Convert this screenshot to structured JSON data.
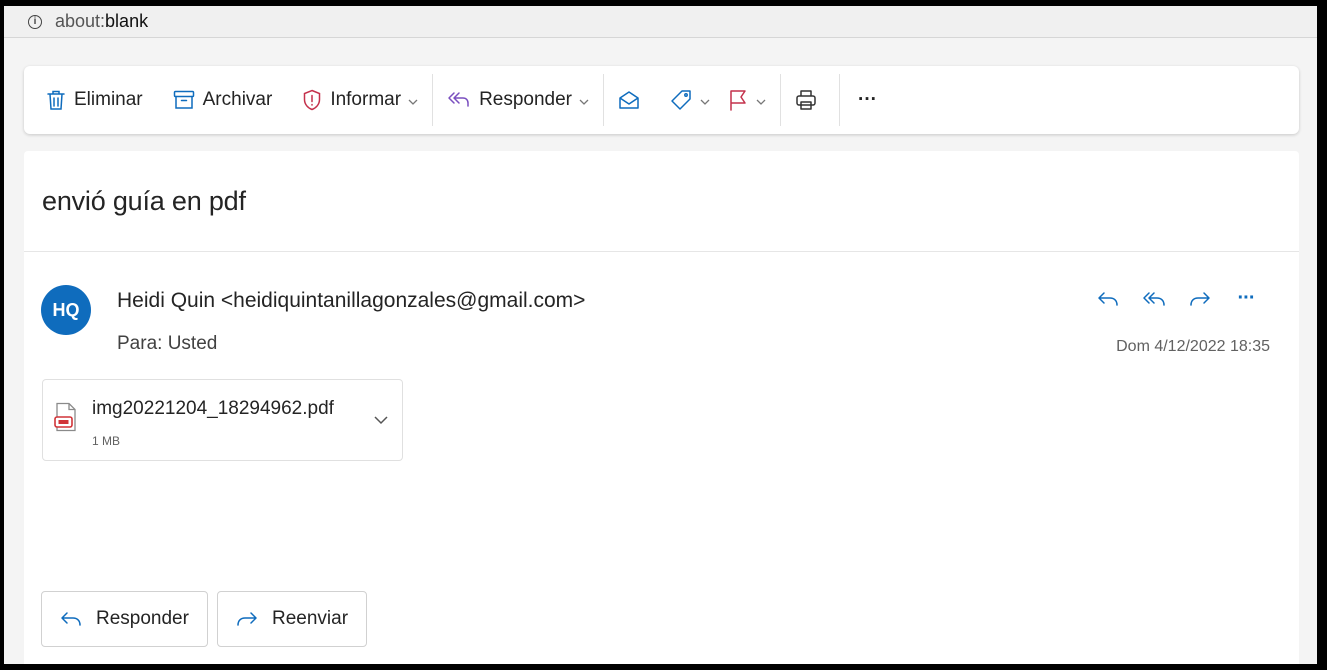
{
  "browser": {
    "info_glyph": "i",
    "url_scheme": "about:",
    "url_host": "blank"
  },
  "toolbar": {
    "delete_label": "Eliminar",
    "archive_label": "Archivar",
    "report_label": "Informar",
    "reply_label": "Responder",
    "more_label": "···"
  },
  "message": {
    "subject": "envió guía en pdf",
    "avatar_initials": "HQ",
    "avatar_color": "#0f6cbd",
    "sender": "Heidi Quin <heidiquintanillagonzales@gmail.com>",
    "to_line": "Para: Usted",
    "date": "Dom 4/12/2022 18:35",
    "more_label": "···"
  },
  "attachment": {
    "name": "img20221204_18294962.pdf",
    "size": "1 MB",
    "icon": "pdf-file-icon"
  },
  "footer": {
    "reply_label": "Responder",
    "forward_label": "Reenviar"
  },
  "colors": {
    "accent": "#0f6cbd",
    "report_red": "#c4314b",
    "pdf_red": "#d13438"
  }
}
